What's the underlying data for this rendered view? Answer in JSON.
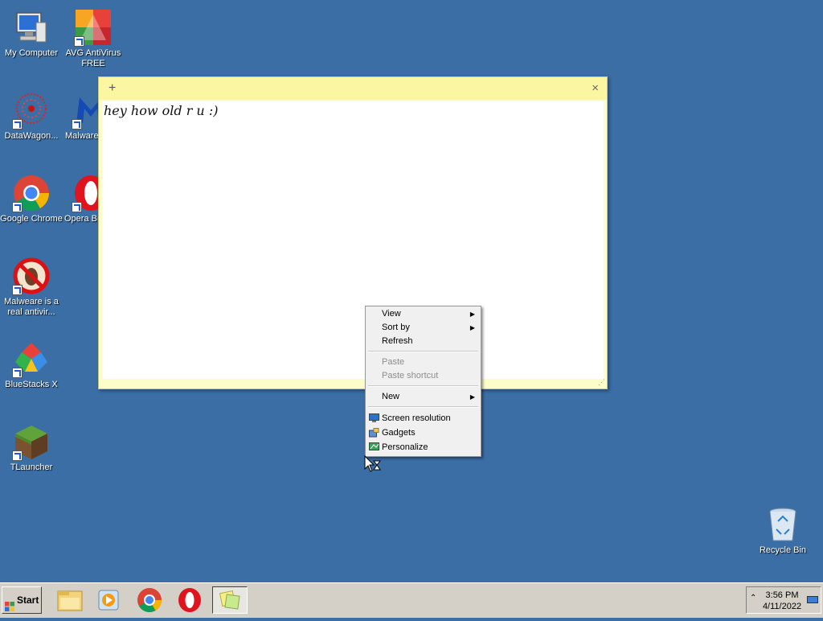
{
  "desktop": {
    "icons": [
      {
        "label": "My Computer"
      },
      {
        "label": "AVG AntiVirus FREE"
      },
      {
        "label": "DataWagon..."
      },
      {
        "label": "Malware..."
      },
      {
        "label": "Google Chrome"
      },
      {
        "label": "Opera Br..."
      },
      {
        "label": "Malweare is a real antivir..."
      },
      {
        "label": "BlueStacks X"
      },
      {
        "label": "TLauncher"
      },
      {
        "label": "Recycle Bin"
      }
    ]
  },
  "sticky_note": {
    "add_symbol": "+",
    "close_symbol": "×",
    "text": "hey how old r u :)"
  },
  "context_menu": {
    "items": [
      {
        "label": "View",
        "submenu": true,
        "enabled": true
      },
      {
        "label": "Sort by",
        "submenu": true,
        "enabled": true
      },
      {
        "label": "Refresh",
        "submenu": false,
        "enabled": true
      },
      {
        "label": "Paste",
        "submenu": false,
        "enabled": false
      },
      {
        "label": "Paste shortcut",
        "submenu": false,
        "enabled": false
      },
      {
        "label": "New",
        "submenu": true,
        "enabled": true
      },
      {
        "label": "Screen resolution",
        "icon": "monitor-icon",
        "enabled": true
      },
      {
        "label": "Gadgets",
        "icon": "gadgets-icon",
        "enabled": true
      },
      {
        "label": "Personalize",
        "icon": "personalize-icon",
        "enabled": true
      }
    ]
  },
  "taskbar": {
    "start_label": "Start",
    "pinned": [
      "file-explorer-icon",
      "media-player-icon",
      "chrome-icon",
      "opera-icon",
      "sticky-notes-icon"
    ],
    "clock_time": "3:56 PM",
    "clock_date": "4/11/2022"
  },
  "colors": {
    "desktop_bg": "#3a6ea5",
    "sticky_bg": "#fdfdc9",
    "menu_bg": "#f0f0f0",
    "taskbar_bg": "#d4d0c8"
  }
}
